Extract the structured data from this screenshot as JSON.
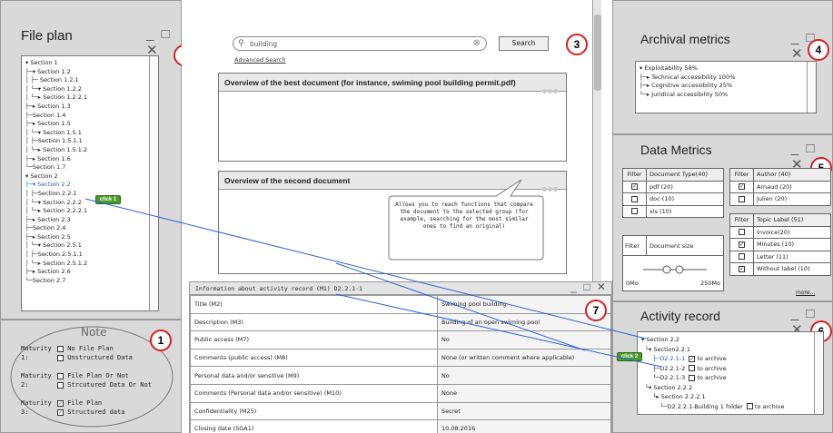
{
  "file_plan": {
    "title": "File plan",
    "window_controls": "_ □ ✕",
    "badge": "2",
    "tree": [
      "▾ Section 1",
      "├─▾ Section 1.2",
      "│  ├─ Section 1.2.1",
      "│  └─▾ Section 1.2.2",
      "│      └─▸ Section 1.2.2.1",
      "├─▸ Section 1.3",
      "├─Section 1.4",
      "├─▸ Section 1.5",
      "│  └─▾ Section 1.5.1",
      "│      ├─Section 1.5.1.1",
      "│      └─▸ Section 1.5.1.2",
      "├─▸ Section 1.6",
      "└─Section 1.7",
      "▾ Section 2",
      "├─▾ Section 2.2",
      "│  ├─Section 2.2.1",
      "│  └─▾ Section 2.2.2",
      "│      └─▸ Section 2.2.2.1",
      "├─▸ Section 2.3",
      "├─Section 2.4",
      "├─▸ Section 2.5",
      "│  └─▾ Section 2.5.1",
      "│      ├─Section 2.5.1.1",
      "│      └─▸ Section 2.5.1.2",
      "├─▸ Section 2.6",
      "└─Section 2.7"
    ],
    "click_label": "click 1"
  },
  "note": {
    "title": "Note",
    "badge": "1",
    "maturity1_label": "Maturity 1:",
    "maturity1_a": "No File Plan",
    "maturity1_b": "Unstructured Data",
    "maturity2_label": "Maturity 2:",
    "maturity2_a": "File Plan Or Not",
    "maturity2_b": "Strcutured Data Or Not",
    "maturity3_label": "Maturity 3:",
    "maturity3_a": "File Plan",
    "maturity3_b": "Structured data",
    "check_mark": "✓"
  },
  "search": {
    "placeholder": "building",
    "button": "Search",
    "advanced": "Advanced Search",
    "badge": "3",
    "clear": "⊗"
  },
  "documents": {
    "best_title": "Overview of the best document (for instance, swiming pool building permit.pdf)",
    "second_title": "Overview of the second document",
    "callout": "Allows you to reach functions that compare the document to the selected group (for example, searching for the most similar ones to find an original)"
  },
  "info": {
    "title": "Information about activity record (M1) D2.2.1-1",
    "window_controls": "_ □ ✕",
    "badge": "7",
    "rows": [
      {
        "label": "Title (M2)",
        "value": "Swiming pool building"
      },
      {
        "label": "Description (M3)",
        "value": "Building of an open swiming pool"
      },
      {
        "label": "Public access (M7)",
        "value": "No"
      },
      {
        "label": "Comments (public access) (M8)",
        "value": "None (or written comment where applicable)"
      },
      {
        "label": "Personal data and/or sensitive (M9)",
        "value": "No"
      },
      {
        "label": "Comments (Personal data and/or sensitive) (M10)",
        "value": "None"
      },
      {
        "label": "Confidentiality (M25)",
        "value": "Secret"
      },
      {
        "label": "Closing date (SGA1)",
        "value": "10.08.2016"
      }
    ]
  },
  "archival_metrics": {
    "title": "Archival metrics",
    "window_controls": "_ □ ✕",
    "badge": "4",
    "items": [
      "▾ Exploitability 58%",
      "├─▸ Technical accessibility 100%",
      "├─▸ Cognitive accessibility 25%",
      "└─▸ Juridical accessibility 50%"
    ]
  },
  "data_metrics": {
    "title": "Data Metrics",
    "window_controls": "_ □ ✕",
    "badge": "5",
    "filter_label": "Filter",
    "doc_type_header": "Document Type(40)",
    "doc_types": [
      {
        "label": "pdf (20)",
        "checked": true
      },
      {
        "label": "doc (10)",
        "checked": false
      },
      {
        "label": "xls (10)",
        "checked": false
      }
    ],
    "author_header": "Author (40)",
    "authors": [
      {
        "label": "Arnaud (20)",
        "checked": true
      },
      {
        "label": "Julien (20)",
        "checked": false
      }
    ],
    "topic_header": "Topic Label (51)",
    "topics": [
      {
        "label": "Invoice(20)",
        "checked": false
      },
      {
        "label": "Minutes (10)",
        "checked": true
      },
      {
        "label": "Letter (11)",
        "checked": false
      },
      {
        "label": "Without label (10)",
        "checked": true
      }
    ],
    "doc_size_label": "Document size",
    "size_min": "0Mo",
    "size_max": "250Mo",
    "more": "more..."
  },
  "activity_record": {
    "title": "Activity record",
    "window_controls": "_ □ ✕",
    "badge": "6",
    "tree": [
      {
        "text": "▾ Section 2.2",
        "archive": false
      },
      {
        "text": "  └▾ Section2.2.1",
        "archive": false
      },
      {
        "text": "      ├─D2.2.1-1",
        "archive": true,
        "checked": true,
        "selected": true
      },
      {
        "text": "      ├─D2.2.1-2",
        "archive": true,
        "checked": false
      },
      {
        "text": "      └─D2.2.1-3",
        "archive": true,
        "checked": false
      },
      {
        "text": "  └▾ Section 2.2.2",
        "archive": false
      },
      {
        "text": "      └▸ Section 2.2.2.1",
        "archive": false
      },
      {
        "text": "          └─D2.2.2.1-Building 1 folder",
        "archive": true,
        "checked": false
      }
    ],
    "archive_label": "to archive",
    "click_label": "click 2"
  },
  "colors": {
    "panel_bg": "#d9d9d9",
    "badge_border": "#d62020",
    "link_line": "#2b5fd9",
    "green_button": "#4a9a2a"
  }
}
